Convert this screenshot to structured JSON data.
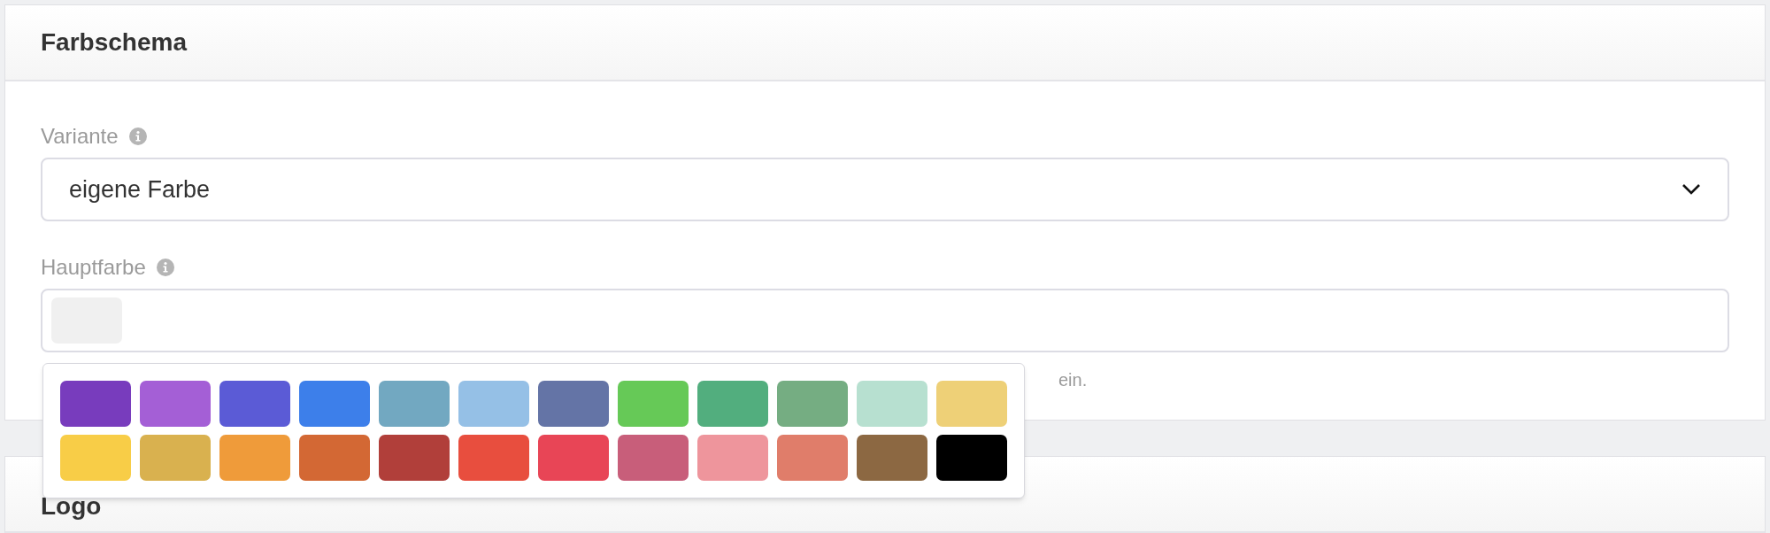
{
  "sections": [
    {
      "title": "Farbschema",
      "fields": [
        {
          "kind": "select",
          "label": "Variante",
          "value": "eigene Farbe"
        },
        {
          "kind": "color",
          "label": "Hauptfarbe",
          "help": "ein.",
          "palette": {
            "open": true,
            "swatches": [
              {
                "color": "#783cbd"
              },
              {
                "color": "#a45fd6"
              },
              {
                "color": "#5b5bd6"
              },
              {
                "color": "#3d7fea"
              },
              {
                "color": "#72a8c1"
              },
              {
                "color": "#95c0e6"
              },
              {
                "color": "#6474a6"
              },
              {
                "color": "#66c957"
              },
              {
                "color": "#52ae7e"
              },
              {
                "color": "#75ad82"
              },
              {
                "color": "#b7e0d0"
              },
              {
                "color": "#eed077"
              },
              {
                "color": "#f8cd47"
              },
              {
                "color": "#d9b14f"
              },
              {
                "color": "#ef9b3a"
              },
              {
                "color": "#d36834"
              },
              {
                "color": "#b13f3a"
              },
              {
                "color": "#e84e3e"
              },
              {
                "color": "#e84556"
              },
              {
                "color": "#c85e7a"
              },
              {
                "color": "#ee959c"
              },
              {
                "color": "#e07d6a"
              },
              {
                "color": "#8c6842"
              },
              {
                "color": "#000000"
              }
            ]
          }
        }
      ]
    },
    {
      "title": "Logo"
    }
  ]
}
